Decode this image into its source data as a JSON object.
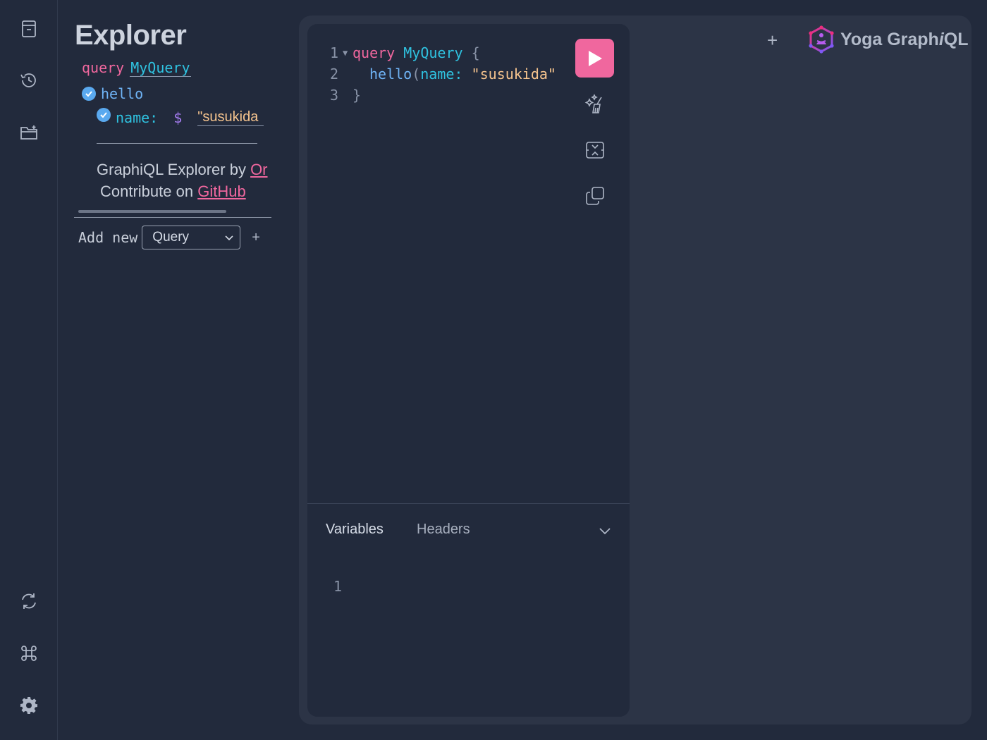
{
  "sidebar_icons": [
    "docs-icon",
    "history-icon",
    "explorer-folder-icon",
    "refetch-schema-icon",
    "shortcuts-icon",
    "settings-icon"
  ],
  "explorer": {
    "title": "Explorer",
    "keyword": "query",
    "operation_name": "MyQuery",
    "field": "hello",
    "arg_name": "name:",
    "dollar": "$",
    "quote": "\"",
    "arg_value": "susukida",
    "credit_prefix": "GraphiQL Explorer by ",
    "credit_link": "Or",
    "contribute_prefix": "Contribute on ",
    "contribute_link": "GitHub",
    "add_new_label": "Add new",
    "add_new_selected": "Query",
    "add_button": "+"
  },
  "editor": {
    "lines": [
      {
        "num": "1",
        "keyword": "query",
        "name": "MyQuery",
        "brace": "{"
      },
      {
        "num": "2",
        "field": "hello",
        "open_paren": "(",
        "arg": "name:",
        "value": "\"susukida\""
      },
      {
        "num": "3",
        "close": "}"
      }
    ],
    "tabs": {
      "variables": "Variables",
      "headers": "Headers"
    },
    "variables_line": "1"
  },
  "header": {
    "new_tab": "+",
    "brand_prefix": "Yoga Graph",
    "brand_italic": "i",
    "brand_suffix": "QL"
  },
  "colors": {
    "accent": "#f0679e",
    "background": "#222a3c",
    "panel": "#2c3446"
  }
}
